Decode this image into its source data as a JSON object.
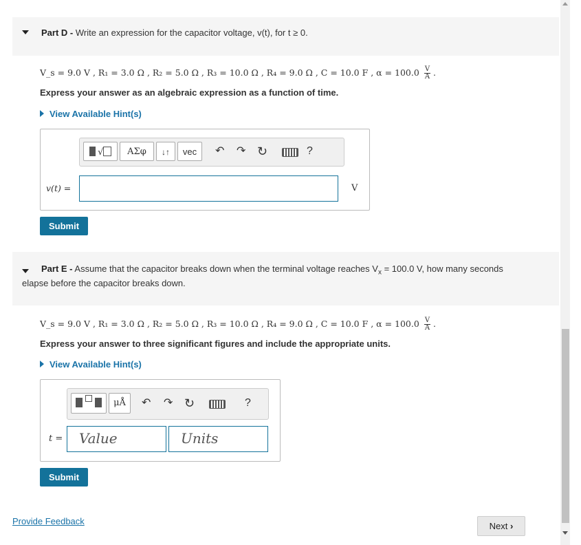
{
  "partD": {
    "label": "Part D -",
    "title": "Write an expression for the capacitor voltage, v(t), for t ≥ 0.",
    "given": "V_s = 9.0 V , R₁ = 3.0 Ω , R₂ = 5.0 Ω , R₃ = 10.0 Ω , R₄ = 9.0 Ω , C = 10.0 F , α = 100.0",
    "given_unit_num": "V",
    "given_unit_den": "A",
    "instruction": "Express your answer as an algebraic expression as a function of time.",
    "hint": "View Available Hint(s)",
    "toolbar": {
      "template_btn": "▮√▢",
      "greek_btn": "ΑΣφ",
      "arrows_btn": "↓↑",
      "vec_btn": "vec",
      "help": "?"
    },
    "var_label": "v(t) =",
    "unit": "V",
    "submit": "Submit"
  },
  "partE": {
    "label": "Part E -",
    "title_line1": "Assume that the capacitor breaks down when the terminal voltage reaches V",
    "title_sub": "x",
    "title_line1b": " = 100.0 V, how many seconds",
    "title_line2": "elapse before the capacitor breaks down.",
    "given": "V_s = 9.0 V , R₁ = 3.0 Ω , R₂ = 5.0 Ω , R₃ = 10.0 Ω , R₄ = 9.0 Ω , C = 10.0 F , α = 100.0",
    "given_unit_num": "V",
    "given_unit_den": "A",
    "instruction": "Express your answer to three significant figures and include the appropriate units.",
    "hint": "View Available Hint(s)",
    "toolbar": {
      "units_btn": "μÅ",
      "help": "?"
    },
    "var_label": "t =",
    "value_placeholder": "Value",
    "units_placeholder": "Units",
    "submit": "Submit"
  },
  "footer": {
    "feedback": "Provide Feedback",
    "next": "Next"
  }
}
